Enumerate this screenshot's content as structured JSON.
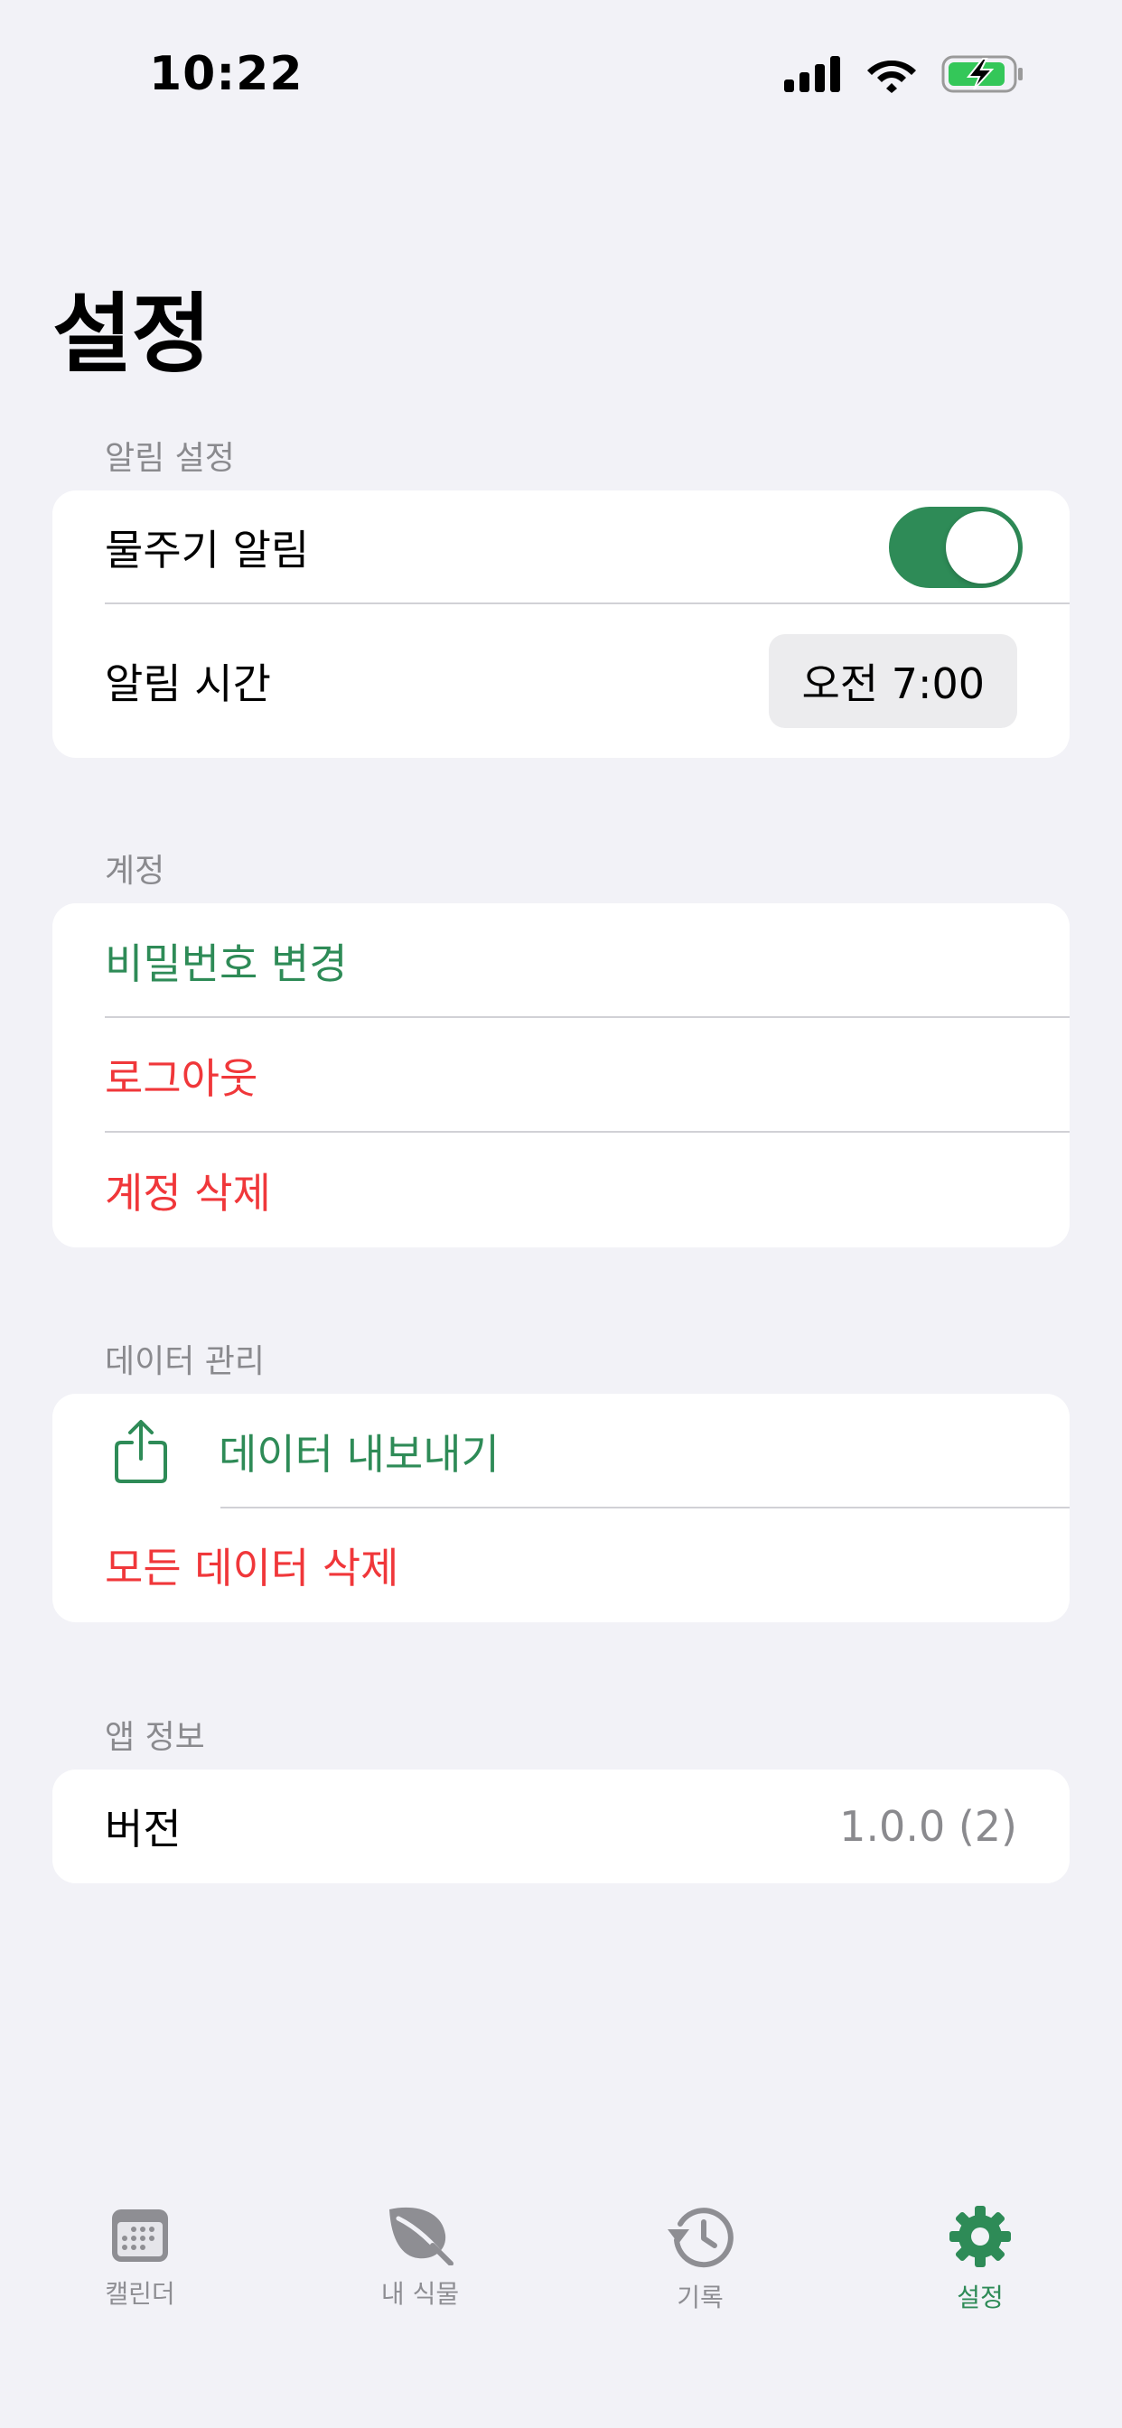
{
  "status_bar": {
    "time": "10:22"
  },
  "page_title": "설정",
  "colors": {
    "accent": "#2e8b57",
    "danger": "#f0373a",
    "secondary_text": "#8a8a8e"
  },
  "notifications": {
    "header": "알림 설정",
    "watering_label": "물주기 알림",
    "watering_enabled": true,
    "time_label": "알림 시간",
    "time_value": "오전 7:00"
  },
  "account": {
    "header": "계정",
    "change_password": "비밀번호 변경",
    "logout": "로그아웃",
    "delete_account": "계정 삭제"
  },
  "data_management": {
    "header": "데이터 관리",
    "export": "데이터 내보내기",
    "export_icon": "share-icon",
    "delete_all": "모든 데이터 삭제"
  },
  "app_info": {
    "header": "앱 정보",
    "version_label": "버전",
    "version_value": "1.0.0 (2)"
  },
  "tabbar": {
    "items": [
      {
        "label": "캘린더",
        "icon": "calendar-icon"
      },
      {
        "label": "내 식물",
        "icon": "leaf-icon"
      },
      {
        "label": "기록",
        "icon": "history-icon"
      },
      {
        "label": "설정",
        "icon": "gear-icon",
        "active": true
      }
    ]
  }
}
